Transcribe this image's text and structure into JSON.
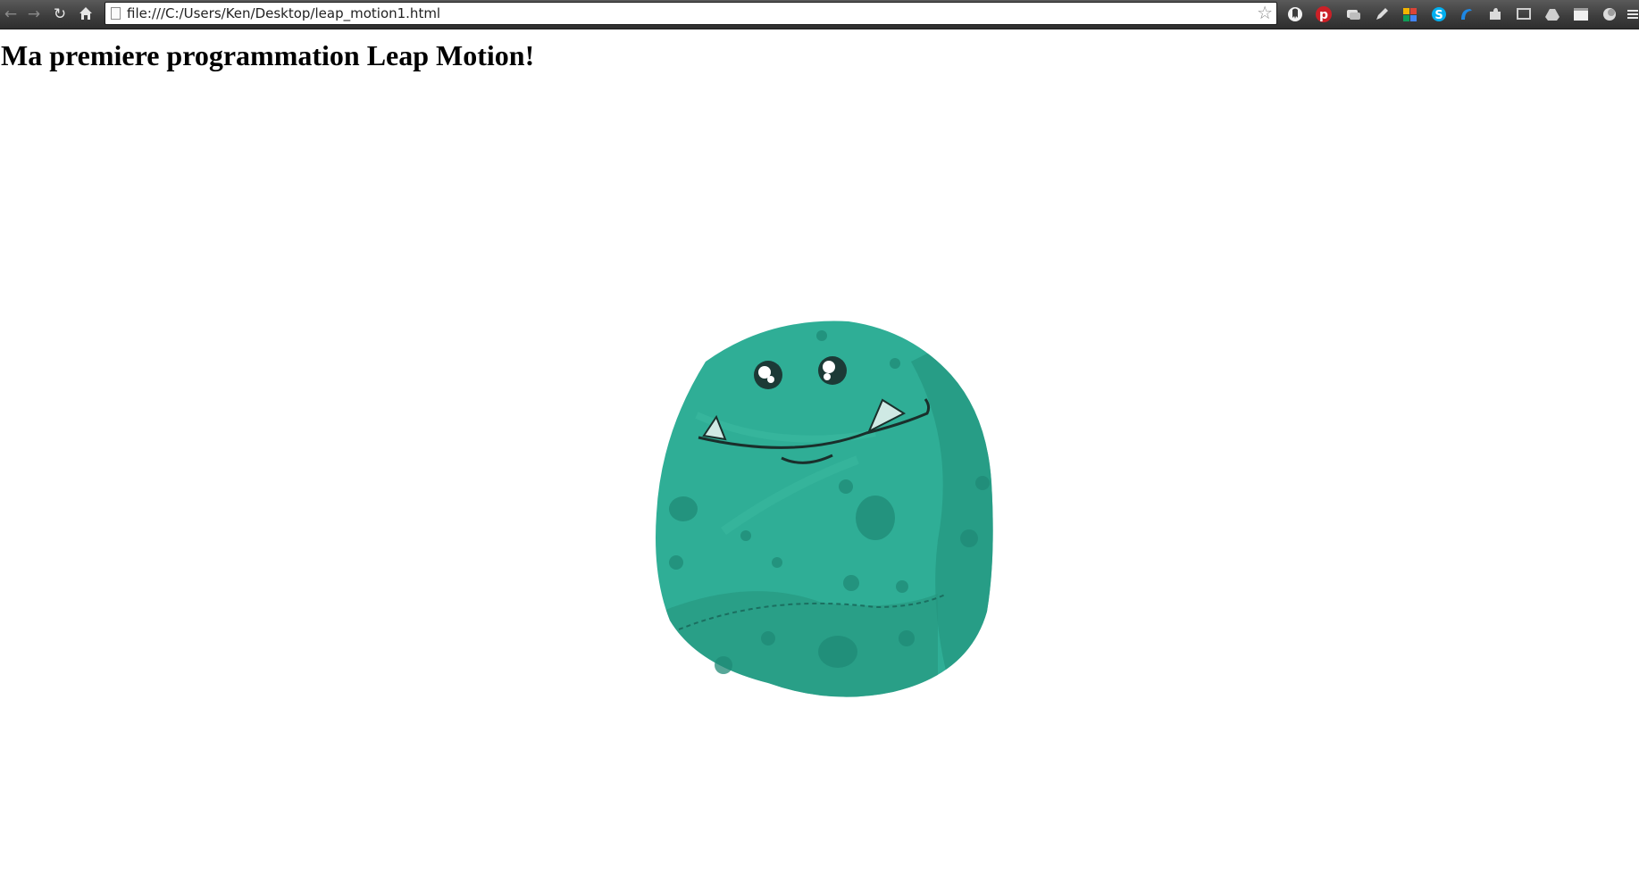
{
  "browser": {
    "url": "file:///C:/Users/Ken/Desktop/leap_motion1.html",
    "extensions": [
      "ghostery-icon",
      "pinterest-icon",
      "chat-icon",
      "pen-icon",
      "google-apps-icon",
      "skype-icon",
      "bookmark-icon",
      "puzzle-icon",
      "cast-icon",
      "drive-icon",
      "window-icon",
      "pocket-icon",
      "menu-icon"
    ]
  },
  "page": {
    "heading": "Ma premiere programmation Leap Motion!"
  },
  "colors": {
    "monster_body": "#2fae96",
    "monster_spots": "#1f8a76"
  }
}
